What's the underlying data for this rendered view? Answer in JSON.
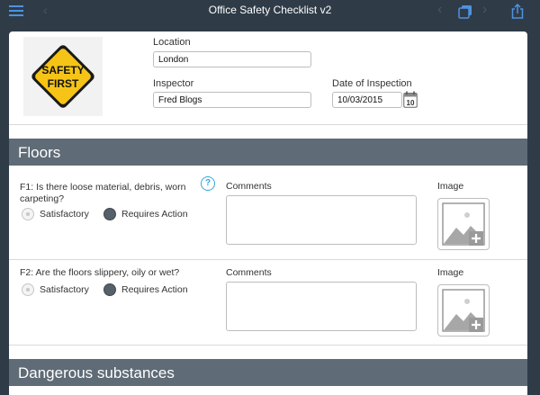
{
  "navbar": {
    "title": "Office Safety Checklist v2",
    "icons": [
      "menu-icon",
      "back-icon",
      "previous-icon",
      "copy-icon",
      "next-icon",
      "share-icon"
    ]
  },
  "header": {
    "logo": {
      "line1": "SAFETY",
      "line2": "FIRST"
    },
    "location": {
      "label": "Location",
      "value": "London"
    },
    "inspector": {
      "label": "Inspector",
      "value": "Fred Blogs"
    },
    "date": {
      "label": "Date of Inspection",
      "value": "10/03/2015",
      "calendar_day": "10"
    }
  },
  "sections": [
    {
      "title": "Floors",
      "questions": [
        {
          "line1": "F1: Is there loose material, debris, worn",
          "line2": "carpeting?",
          "options": [
            "Satisfactory",
            "Requires Action"
          ],
          "selected": "Requires Action",
          "comments_label": "Comments",
          "image_label": "Image"
        },
        {
          "line1": "F2: Are the floors slippery, oily or wet?",
          "options": [
            "Satisfactory",
            "Requires Action"
          ],
          "selected": "Requires Action",
          "comments_label": "Comments",
          "image_label": "Image"
        }
      ]
    },
    {
      "title": "Dangerous substances"
    }
  ],
  "colors": {
    "navbar_bg": "#2f3c48",
    "section_header_bg": "#5f6b76",
    "accent_blue": "#4f92e0",
    "help_blue": "#33a7d8",
    "logo_yellow": "#f6c416"
  }
}
